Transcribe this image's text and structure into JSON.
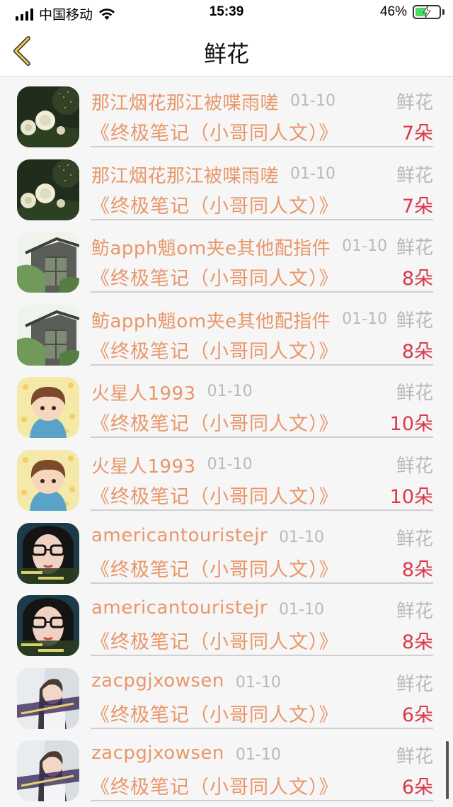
{
  "status_bar": {
    "carrier": "中国移动",
    "time": "15:39",
    "battery_pct": "46%",
    "battery_level": 0.46
  },
  "nav": {
    "title": "鲜花"
  },
  "items": [
    {
      "name": "那江烟花那江被喋雨嗟",
      "date": "01-10",
      "gift": "鲜花",
      "subtitle": "《终极笔记（小哥同人文）》",
      "count": "7朵",
      "avatar": "white-roses"
    },
    {
      "name": "那江烟花那江被喋雨嗟",
      "date": "01-10",
      "gift": "鲜花",
      "subtitle": "《终极笔记（小哥同人文）》",
      "count": "7朵",
      "avatar": "white-roses"
    },
    {
      "name": "鲂apph魈om夹e其他配指件",
      "date": "01-10",
      "gift": "鲜花",
      "subtitle": "《终极笔记（小哥同人文）》",
      "count": "8朵",
      "avatar": "garden-house"
    },
    {
      "name": "鲂apph魈om夹e其他配指件",
      "date": "01-10",
      "gift": "鲜花",
      "subtitle": "《终极笔记（小哥同人文）》",
      "count": "8朵",
      "avatar": "garden-house"
    },
    {
      "name": "火星人1993",
      "date": "01-10",
      "gift": "鲜花",
      "subtitle": "《终极笔记（小哥同人文）》",
      "count": "10朵",
      "avatar": "cartoon-boy"
    },
    {
      "name": "火星人1993",
      "date": "01-10",
      "gift": "鲜花",
      "subtitle": "《终极笔记（小哥同人文）》",
      "count": "10朵",
      "avatar": "cartoon-boy"
    },
    {
      "name": "americantouristejr",
      "date": "01-10",
      "gift": "鲜花",
      "subtitle": "《终极笔记（小哥同人文）》",
      "count": "8朵",
      "avatar": "girl-glasses"
    },
    {
      "name": "americantouristejr",
      "date": "01-10",
      "gift": "鲜花",
      "subtitle": "《终极笔记（小哥同人文）》",
      "count": "8朵",
      "avatar": "girl-glasses"
    },
    {
      "name": "zacpgjxowsen",
      "date": "01-10",
      "gift": "鲜花",
      "subtitle": "《终极笔记（小哥同人文）》",
      "count": "6朵",
      "avatar": "girl-photo"
    },
    {
      "name": "zacpgjxowsen",
      "date": "01-10",
      "gift": "鲜花",
      "subtitle": "《终极笔记（小哥同人文）》",
      "count": "6朵",
      "avatar": "girl-photo"
    }
  ]
}
